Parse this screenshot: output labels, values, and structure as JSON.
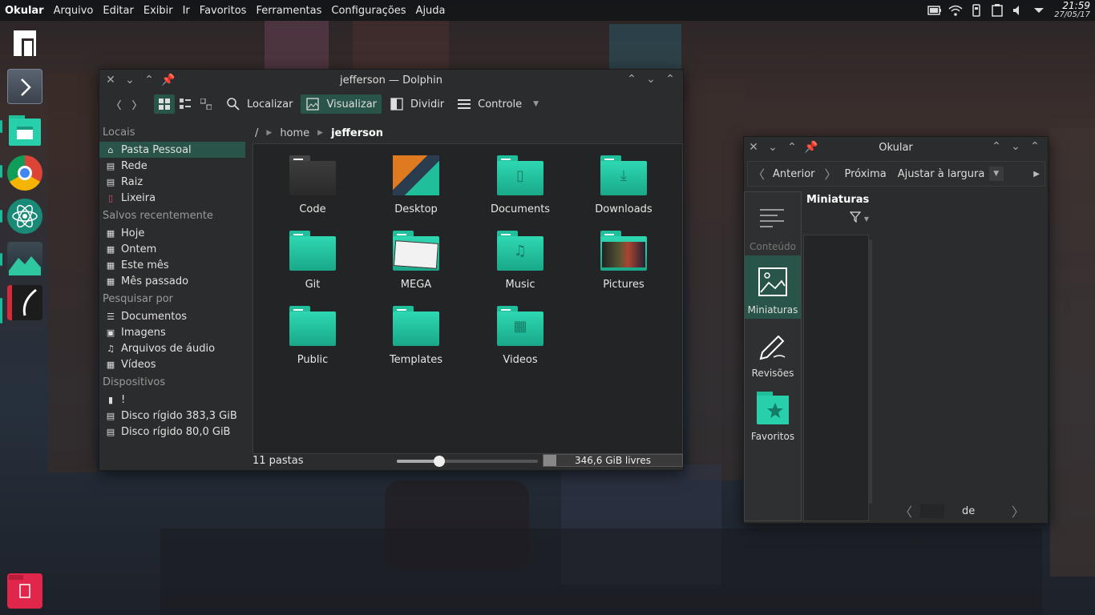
{
  "topbar": {
    "app_name": "Okular",
    "menus": [
      "Arquivo",
      "Editar",
      "Exibir",
      "Ir",
      "Favoritos",
      "Ferramentas",
      "Configurações",
      "Ajuda"
    ],
    "clock_time": "21:59",
    "clock_date": "27/05/17",
    "tray_icons": [
      "battery-icon",
      "wifi-icon",
      "usb-icon",
      "clipboard-icon",
      "volume-icon",
      "chevron-down-icon"
    ]
  },
  "dock": {
    "items": [
      "manjaro-icon",
      "next-icon",
      "files-icon",
      "chrome-icon",
      "atom-icon",
      "image-viewer-icon",
      "okular-icon",
      "trash-icon"
    ]
  },
  "dolphin": {
    "title": "jefferson — Dolphin",
    "toolbar": {
      "find": "Localizar",
      "preview": "Visualizar",
      "split": "Dividir",
      "control": "Controle"
    },
    "places": {
      "sections": [
        {
          "title": "Locais",
          "items": [
            {
              "label": "Pasta Pessoal",
              "icon": "home-icon",
              "selected": true
            },
            {
              "label": "Rede",
              "icon": "network-icon"
            },
            {
              "label": "Raiz",
              "icon": "root-drive-icon"
            },
            {
              "label": "Lixeira",
              "icon": "trash-icon"
            }
          ]
        },
        {
          "title": "Salvos recentemente",
          "items": [
            {
              "label": "Hoje",
              "icon": "calendar-icon"
            },
            {
              "label": "Ontem",
              "icon": "calendar-icon"
            },
            {
              "label": "Este mês",
              "icon": "calendar-icon"
            },
            {
              "label": "Mês passado",
              "icon": "calendar-icon"
            }
          ]
        },
        {
          "title": "Pesquisar por",
          "items": [
            {
              "label": "Documentos",
              "icon": "document-icon"
            },
            {
              "label": "Imagens",
              "icon": "image-icon"
            },
            {
              "label": "Arquivos de áudio",
              "icon": "music-icon"
            },
            {
              "label": "Vídeos",
              "icon": "video-icon"
            }
          ]
        },
        {
          "title": "Dispositivos",
          "items": [
            {
              "label": "!",
              "icon": "usb-device-icon"
            },
            {
              "label": "Disco rígido 383,3 GiB",
              "icon": "hard-disk-icon"
            },
            {
              "label": "Disco rígido 80,0 GiB",
              "icon": "hard-disk-icon"
            }
          ]
        }
      ]
    },
    "breadcrumb": {
      "root": "/",
      "items": [
        "home"
      ],
      "current": "jefferson"
    },
    "files": [
      {
        "name": "Code",
        "kind": "dark"
      },
      {
        "name": "Desktop",
        "kind": "desktop"
      },
      {
        "name": "Documents",
        "kind": "folder",
        "symbol": "▯"
      },
      {
        "name": "Downloads",
        "kind": "folder",
        "symbol": "⤓"
      },
      {
        "name": "Git",
        "kind": "folder",
        "symbol": ""
      },
      {
        "name": "MEGA",
        "kind": "mega"
      },
      {
        "name": "Music",
        "kind": "folder",
        "symbol": "♫"
      },
      {
        "name": "Pictures",
        "kind": "pictures"
      },
      {
        "name": "Public",
        "kind": "folder",
        "symbol": ""
      },
      {
        "name": "Templates",
        "kind": "folder",
        "symbol": ""
      },
      {
        "name": "Videos",
        "kind": "folder",
        "symbol": "▦"
      }
    ],
    "status": {
      "count": "11 pastas",
      "free": "346,6 GiB livres",
      "zoom_fraction": 0.3,
      "used_fraction": 0.09
    }
  },
  "okular": {
    "title": "Okular",
    "toolbar": {
      "prev": "Anterior",
      "next": "Próxima",
      "zoom": "Ajustar à largura"
    },
    "sidebar": [
      {
        "label": "Conteúdo",
        "icon": "contents-icon",
        "state": "dim"
      },
      {
        "label": "Miniaturas",
        "icon": "thumbnails-icon",
        "state": "sel"
      },
      {
        "label": "Revisões",
        "icon": "reviews-icon",
        "state": ""
      },
      {
        "label": "Favoritos",
        "icon": "bookmarks-icon",
        "state": ""
      }
    ],
    "panel_title": "Miniaturas",
    "page_of": "de"
  }
}
